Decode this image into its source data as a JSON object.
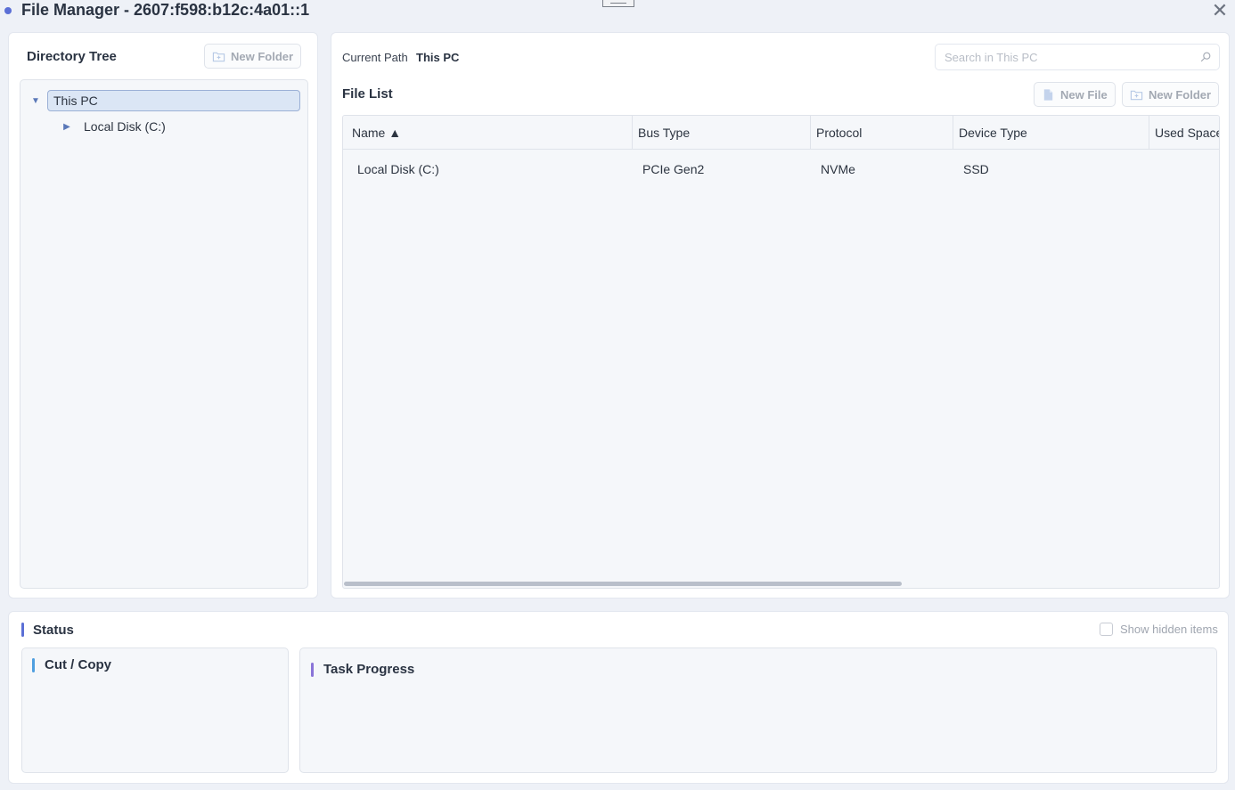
{
  "window": {
    "title": "File Manager - 2607:f598:b12c:4a01::1",
    "close_glyph": "✕"
  },
  "directory_tree": {
    "title": "Directory Tree",
    "new_folder_label": "New Folder",
    "nodes": [
      {
        "label": "This PC",
        "expanded": true,
        "selected": true
      },
      {
        "label": "Local Disk (C:)",
        "expanded": false,
        "selected": false
      }
    ]
  },
  "file_panel": {
    "current_path_label": "Current Path",
    "current_path_value": "This PC",
    "search_placeholder": "Search in This PC",
    "file_list_title": "File List",
    "new_file_label": "New File",
    "new_folder_label": "New Folder",
    "columns": [
      "Name ▲",
      "Bus Type",
      "Protocol",
      "Device Type",
      "Used Space"
    ],
    "rows": [
      {
        "name": "Local Disk (C:)",
        "bus_type": "PCIe Gen2",
        "protocol": "NVMe",
        "device_type": "SSD",
        "used_space": ""
      }
    ]
  },
  "status": {
    "title": "Status",
    "show_hidden_label": "Show hidden items",
    "show_hidden_checked": false,
    "cut_copy_title": "Cut / Copy",
    "task_progress_title": "Task Progress"
  },
  "colors": {
    "accent": "#5b6fd6",
    "status_accent": "#5b6fd6",
    "cut_copy_accent": "#4f9fe0",
    "task_progress_accent": "#8a74d8"
  }
}
